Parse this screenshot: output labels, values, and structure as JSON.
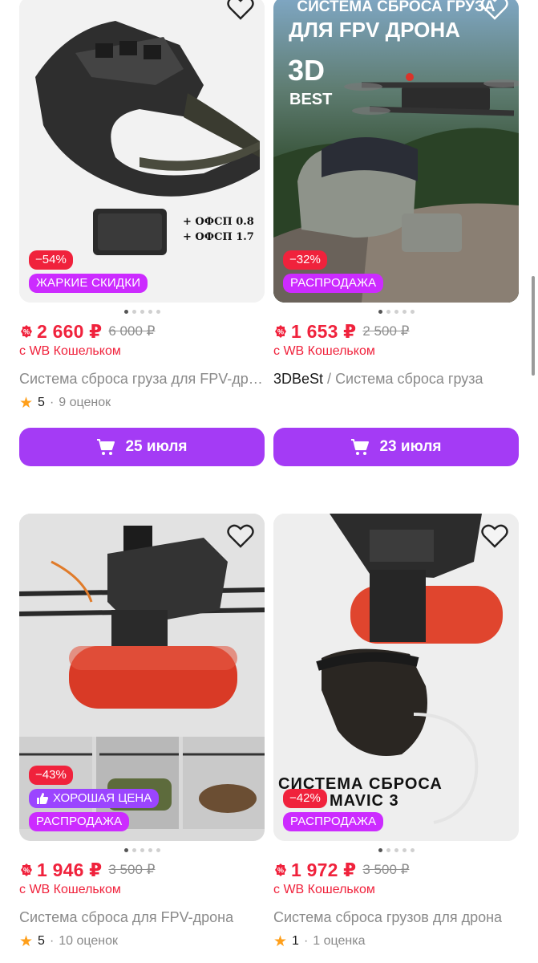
{
  "products": [
    {
      "discount": "−54%",
      "promo_badges": [
        "ЖАРКИЕ СКИДКИ"
      ],
      "photo_text": [
        "+ ОФСП 0.8",
        "+ ОФСП 1.7"
      ],
      "price": "2 660 ₽",
      "old_price": "6 000 ₽",
      "wallet_note": "с WB Кошельком",
      "brand": "",
      "title": "Система сброса груза для FPV-дрона",
      "rating": "5",
      "reviews": "9 оценок",
      "delivery": "25 июля",
      "photo_dots": 5,
      "active_dot": 0
    },
    {
      "discount": "−32%",
      "promo_badges": [
        "РАСПРОДАЖА"
      ],
      "photo_text": [
        "СИСТЕМА СБРОСА ГРУЗА",
        "ДЛЯ FPV ДРОНА",
        "3D",
        "BEST"
      ],
      "price": "1 653 ₽",
      "old_price": "2 500 ₽",
      "wallet_note": "с WB Кошельком",
      "brand": "3DBeSt",
      "title": "Система сброса груза",
      "delivery": "23 июля",
      "photo_dots": 5,
      "active_dot": 0
    },
    {
      "discount": "−43%",
      "good_price": "ХОРОШАЯ ЦЕНА",
      "promo_badges": [
        "РАСПРОДАЖА"
      ],
      "price": "1 946 ₽",
      "old_price": "3 500 ₽",
      "wallet_note": "с WB Кошельком",
      "brand": "",
      "title": "Система сброса для FPV-дрона",
      "rating": "5",
      "reviews": "10 оценок",
      "photo_dots": 5,
      "active_dot": 0
    },
    {
      "discount": "−42%",
      "promo_badges": [
        "РАСПРОДАЖА"
      ],
      "photo_text": [
        "СИСТЕМА СБРОСА",
        "MAVIC 3"
      ],
      "price": "1 972 ₽",
      "old_price": "3 500 ₽",
      "wallet_note": "с WB Кошельком",
      "brand": "",
      "title": "Система сброса грузов для дрона",
      "rating": "1",
      "reviews": "1 оценка",
      "photo_dots": 5,
      "active_dot": 0
    }
  ],
  "colors": {
    "price_red": "#f0223c",
    "sale_pink": "#cc2bff",
    "good_price_purple": "#9b45ff",
    "cart_button": "#a43bf5",
    "star": "#ff9f1a"
  },
  "icons": {
    "favorite": "heart-outline-icon",
    "wallet": "wallet-discount-icon",
    "cart": "shopping-cart-icon",
    "rating": "star-icon",
    "good_price": "thumbs-up-icon"
  }
}
